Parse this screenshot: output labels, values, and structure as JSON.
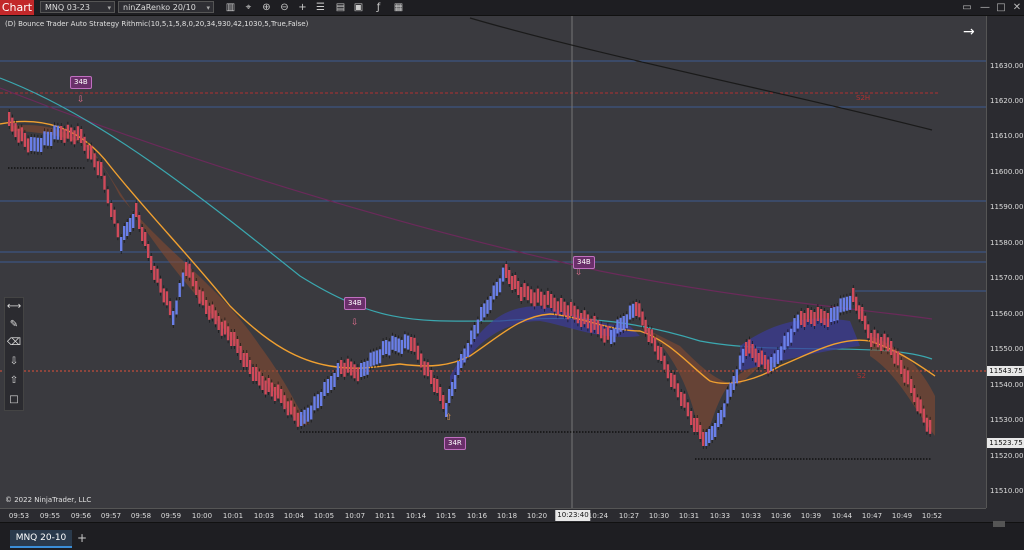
{
  "toolbar": {
    "chart_tab": "Chart",
    "instrument": "MNQ 03-23",
    "bar_type": "ninZaRenko 20/10",
    "tools": [
      "bars-icon",
      "crosshair-icon",
      "zoom-in-icon",
      "zoom-out-icon",
      "plus-icon",
      "properties-icon",
      "strategy-icon",
      "template-icon",
      "indicator-icon",
      "datasource-icon"
    ],
    "window": [
      "pin-icon",
      "minimize-icon",
      "maximize-icon",
      "close-icon"
    ]
  },
  "indicator_label": "(D) Bounce Trader Auto Strategy Rithmic(10,5,1,5,8,0,20,34,930,42,1030,5,True,False)",
  "copyright": "© 2022 NinjaTrader, LLC",
  "price_axis": {
    "ticks": [
      "11630.00",
      "11620.00",
      "11610.00",
      "11600.00",
      "11590.00",
      "11580.00",
      "11570.00",
      "11560.00",
      "11550.00",
      "11540.00",
      "11530.00",
      "11520.00",
      "11510.00"
    ],
    "current_price": "11543.75",
    "low_price": "11523.75"
  },
  "time_axis": {
    "ticks": [
      "09:53",
      "09:55",
      "09:56",
      "09:57",
      "09:58",
      "09:59",
      "10:00",
      "10:01",
      "10:03",
      "10:04",
      "10:05",
      "10:07",
      "10:11",
      "10:14",
      "10:15",
      "10:16",
      "10:18",
      "10:20",
      "10:24",
      "10:27",
      "10:30",
      "10:31",
      "10:33",
      "10:33",
      "10:36",
      "10:39",
      "10:44",
      "10:47",
      "10:49",
      "10:52"
    ],
    "crosshair_time": "10:23:40"
  },
  "tags": [
    "34B",
    "34B",
    "34B",
    "34R"
  ],
  "level_labels": [
    "S2H",
    "S2"
  ],
  "bottom": {
    "tab": "MNQ 20-10",
    "add": "+"
  },
  "buttons": {
    "f": "F",
    "arrow": "→"
  },
  "colors": {
    "bull": "#6a7fe8",
    "bear": "#d04a5a",
    "ema_orange": "#f0a030",
    "ema_teal": "#3aa8b0",
    "cloud_bull": "#3a3a9a",
    "cloud_bear": "#8a4a30",
    "price_line": "#e0503a",
    "level_blue": "#3c5a90"
  }
}
